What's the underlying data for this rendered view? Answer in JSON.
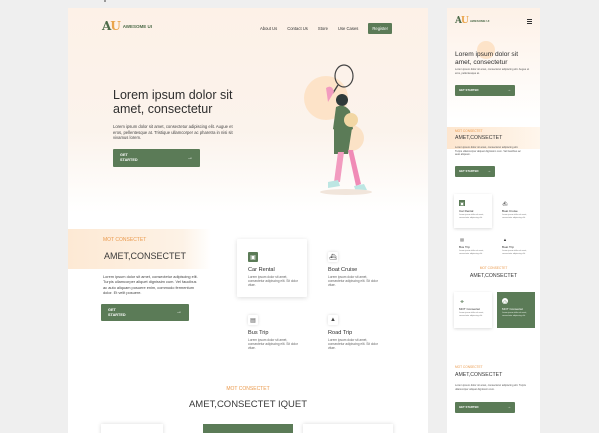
{
  "brand": {
    "logo_a": "A",
    "logo_u": "U",
    "name": "AWESOME UI"
  },
  "nav": {
    "items": [
      "About Us",
      "Contact Us",
      "Store",
      "Use Cases"
    ],
    "register": "Register"
  },
  "hero": {
    "title": "Lorem ipsum dolor sit amet, consectetur",
    "body": "Lorem ipsum dolor sit amet, consectetur adipiscing elit. Augue et eros, pellentesque at. Tristique ullamcorper ac pharetra in nisi sit vivamus lorem.",
    "button": "GET STARTED"
  },
  "section2": {
    "eyebrow": "MOT CONSECTET",
    "title": "AMET,CONSECTET",
    "body": "Lorem ipsum dolor sit amet, consectetur adipiscing elit. Turpis ullamcorper aliquet dignissim cum. Vel faucibus ac auto aliquam posuere enim, commodo fermentum dolor. Et velit posuere.",
    "button": "GET STARTED"
  },
  "services": [
    {
      "name": "Car Rental",
      "desc": "Lorem ipsum dolor sit amet, consectetur adipiscing elit. Sit dolor vitae.",
      "icon": "car-icon"
    },
    {
      "name": "Boat Cruise",
      "desc": "Lorem ipsum dolor sit amet, consectetur adipiscing elit. Sit dolor vitae.",
      "icon": "boat-icon"
    },
    {
      "name": "Bus Trip",
      "desc": "Lorem ipsum dolor sit amet, consectetur adipiscing elit. Sit dolor vitae.",
      "icon": "bus-icon"
    },
    {
      "name": "Road Trip",
      "desc": "Lorem ipsum dolor sit amet, consectetur adipiscing elit. Sit dolor vitae.",
      "icon": "road-icon"
    }
  ],
  "section3": {
    "eyebrow": "MOT CONSECTET",
    "title": "AMET,CONSECTET IQUET"
  },
  "mobile": {
    "title": "Lorem ipsum dolor sit amet, consectetur",
    "body": "Lorem ipsum dolor sit amet, consectetur adipiscing elit. Augue et eros, pellentesque at.",
    "button": "GET STARTED",
    "eyebrow": "MOT CONSECTET",
    "section_title": "AMET,CONSECTET",
    "section_body": "Lorem ipsum dolor sit amet, consectetur adipiscing elit. Turpis ullamcorper aliquet dignissim cum. Vel faucibus ac auto aliquam.",
    "button2": "GET STARTED",
    "cards": [
      "Car Rental",
      "Boat Cruise",
      "Bus Trip",
      "Boat Trip"
    ],
    "eyebrow2": "MOT CONSECTET",
    "title2": "AMET,CONSECTET",
    "cards2": [
      "MOT Consectet",
      "MOT Consectet"
    ],
    "eyebrow3": "MOT CONSECTET",
    "title3": "AMET,CONSECTET",
    "body3": "Lorem ipsum dolor sit amet, consectetur adipiscing elit. Turpis ullamcorper aliquet dignissim cum.",
    "button3": "GET STARTED",
    "card_desc": "Lorem ipsum dolor sit amet, consectetur adipiscing elit."
  },
  "colors": {
    "primary": "#5b7b57",
    "accent": "#ea9a4d",
    "hero_bg": "#fdf1e7"
  }
}
